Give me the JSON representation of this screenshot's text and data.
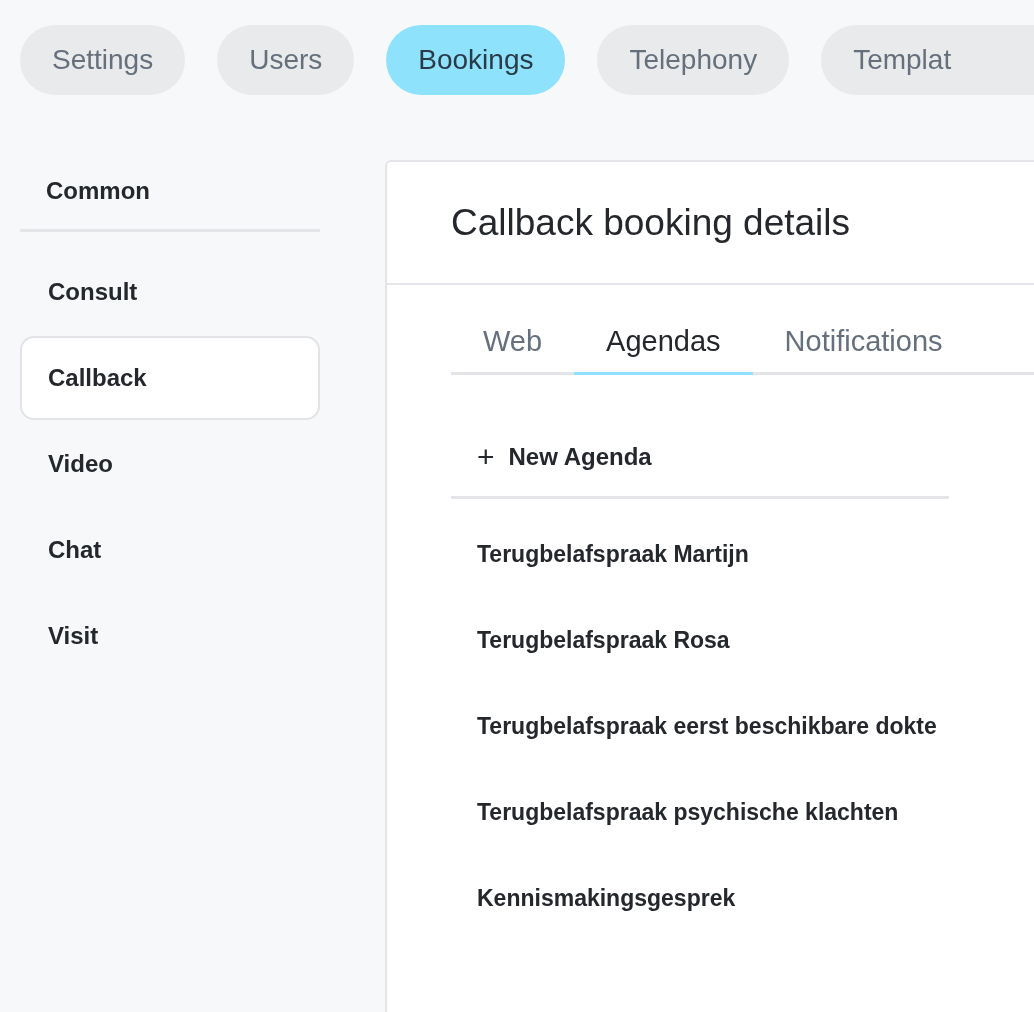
{
  "top_tabs": [
    {
      "label": "Settings",
      "selected": false
    },
    {
      "label": "Users",
      "selected": false
    },
    {
      "label": "Bookings",
      "selected": true
    },
    {
      "label": "Telephony",
      "selected": false
    },
    {
      "label": "Templat",
      "selected": false
    }
  ],
  "sidebar": {
    "items": [
      {
        "label": "Common",
        "kind": "heading"
      },
      {
        "label": "Consult",
        "selected": false,
        "kind": "item"
      },
      {
        "label": "Callback",
        "selected": true,
        "kind": "item"
      },
      {
        "label": "Video",
        "selected": false,
        "kind": "item"
      },
      {
        "label": "Chat",
        "selected": false,
        "kind": "item"
      },
      {
        "label": "Visit",
        "selected": false,
        "kind": "item"
      }
    ]
  },
  "panel": {
    "title": "Callback booking details",
    "tabs": [
      {
        "label": "Web",
        "selected": false
      },
      {
        "label": "Agendas",
        "selected": true
      },
      {
        "label": "Notifications",
        "selected": false
      }
    ],
    "new_button": {
      "icon": "+",
      "label": "New Agenda"
    },
    "agendas": [
      "Terugbelafspraak Martijn",
      "Terugbelafspraak Rosa",
      "Terugbelafspraak eerst beschikbare dokte",
      "Terugbelafspraak psychische klachten",
      "Kennismakingsgesprek"
    ]
  }
}
